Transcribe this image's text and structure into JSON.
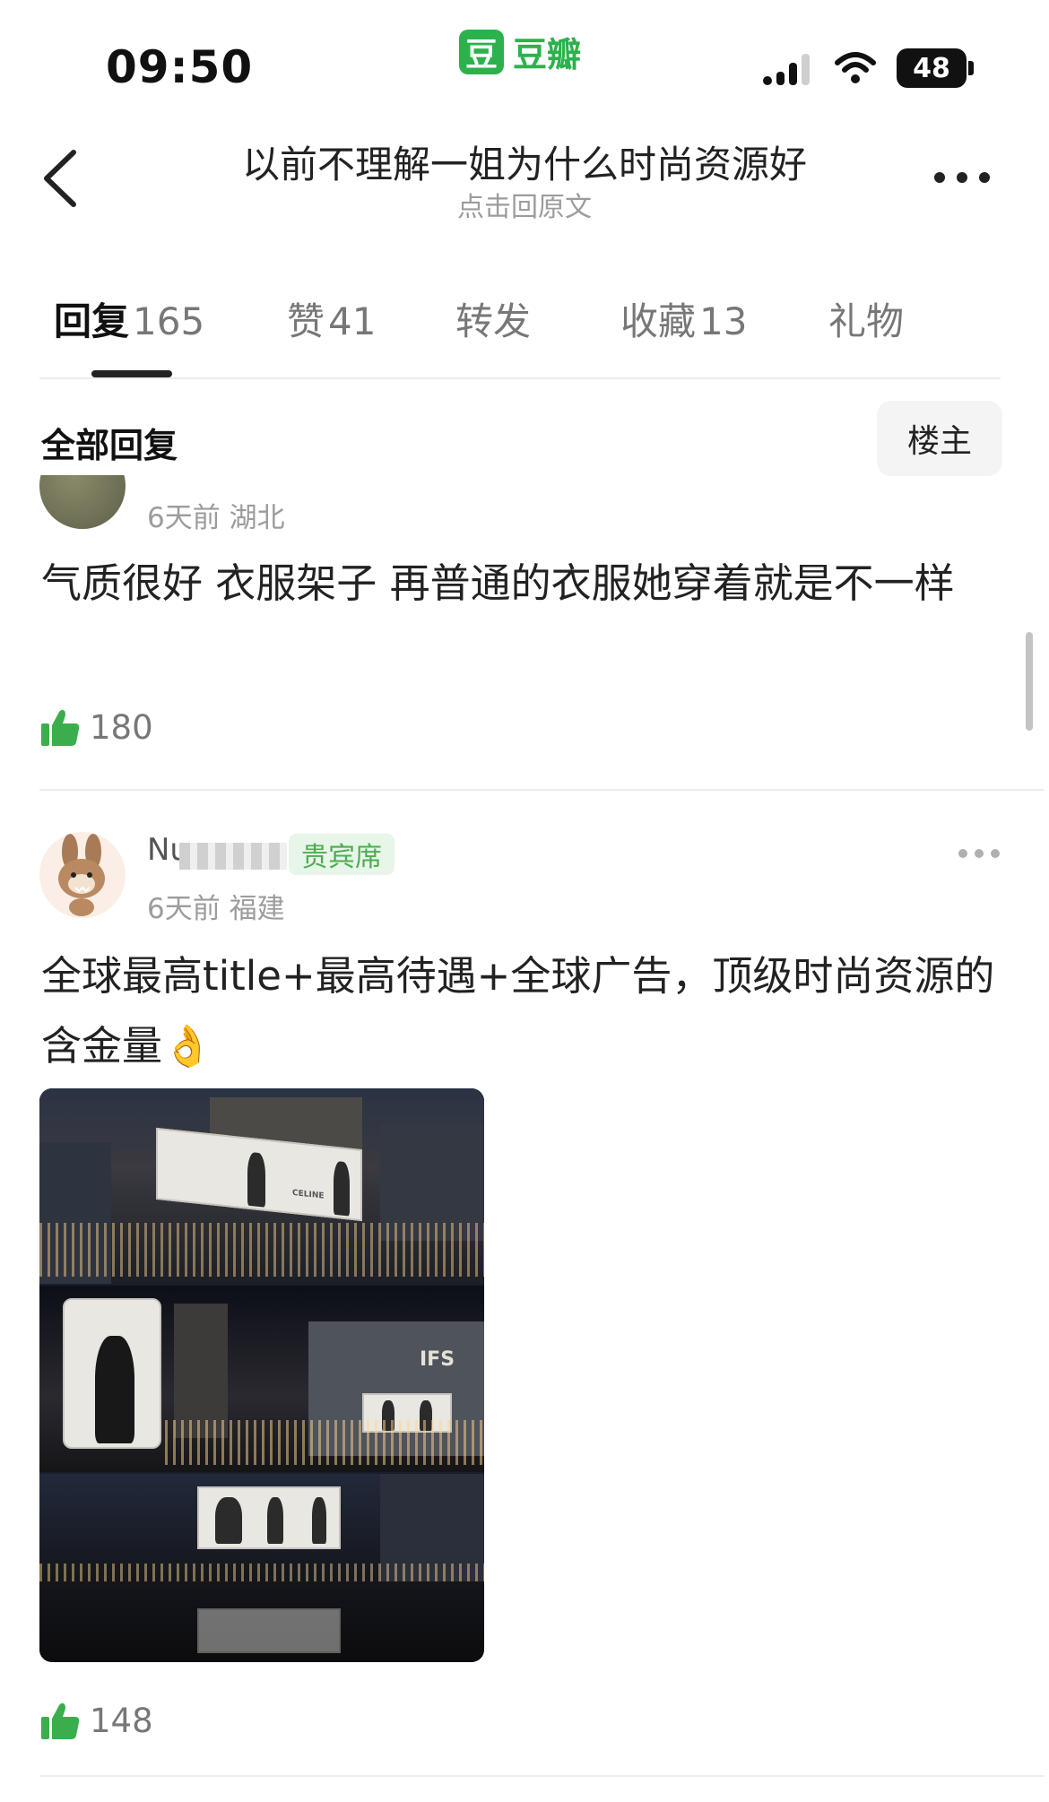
{
  "status_bar": {
    "time": "09:50",
    "app_name": "豆瓣",
    "app_icon_glyph": "豆",
    "battery": "48"
  },
  "nav": {
    "title": "以前不理解一姐为什么时尚资源好",
    "subtitle": "点击回原文"
  },
  "tabs": [
    {
      "label": "回复",
      "count": "165",
      "active": true
    },
    {
      "label": "赞",
      "count": "41",
      "active": false
    },
    {
      "label": "转发",
      "count": "",
      "active": false
    },
    {
      "label": "收藏",
      "count": "13",
      "active": false
    },
    {
      "label": "礼物",
      "count": "",
      "active": false
    }
  ],
  "filter": {
    "title": "全部回复",
    "op_button": "楼主"
  },
  "comments": [
    {
      "meta": "6天前 湖北",
      "body": "气质很好  衣服架子  再普通的衣服她穿着就是不一样",
      "likes": "180"
    },
    {
      "username": "Nuye",
      "badge": "贵宾席",
      "meta": "6天前 福建",
      "body": "全球最高title+最高待遇+全球广告，顶级时尚资源的含金量👌",
      "photo_sign_1": "CELINE",
      "photo_sign_2": "IFS",
      "likes": "148"
    }
  ],
  "colors": {
    "brand_green": "#2bb24c",
    "like_green": "#3aae4c",
    "muted_text": "#9c9c9c"
  }
}
